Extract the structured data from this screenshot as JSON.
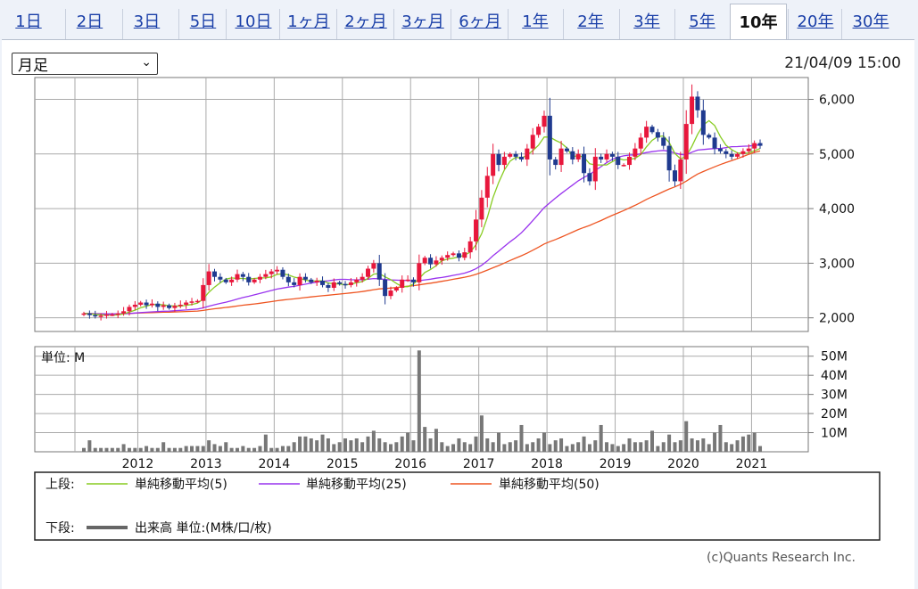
{
  "tabs": [
    {
      "label": "1日"
    },
    {
      "label": "2日"
    },
    {
      "label": "3日"
    },
    {
      "label": "5日"
    },
    {
      "label": "10日"
    },
    {
      "label": "1ヶ月"
    },
    {
      "label": "2ヶ月"
    },
    {
      "label": "3ヶ月"
    },
    {
      "label": "6ヶ月"
    },
    {
      "label": "1年"
    },
    {
      "label": "2年"
    },
    {
      "label": "3年"
    },
    {
      "label": "5年"
    },
    {
      "label": "10年",
      "active": true
    },
    {
      "label": "20年"
    },
    {
      "label": "30年"
    }
  ],
  "period_select": {
    "value": "月足"
  },
  "datetime": "21/04/09 15:00",
  "volume_unit_label": "単位: M",
  "legend": {
    "upper_label": "上段:",
    "lower_label": "下段:",
    "items": [
      {
        "label": "単純移動平均(5)",
        "color": "#88cc22"
      },
      {
        "label": "単純移動平均(25)",
        "color": "#9933ee"
      },
      {
        "label": "単純移動平均(50)",
        "color": "#ee5522"
      }
    ],
    "volume_item": {
      "label": "出来高 単位:(M株/口/枚)",
      "color": "#666666"
    }
  },
  "copyright": "(c)Quants Research Inc.",
  "chart_data": {
    "type": "candlestick",
    "x_labels": [
      "2012",
      "2013",
      "2014",
      "2015",
      "2016",
      "2017",
      "2018",
      "2019",
      "2020",
      "2021"
    ],
    "price_axis": {
      "ticks": [
        "6,000",
        "5,000",
        "4,000",
        "3,000",
        "2,000"
      ],
      "min": 1750,
      "max": 6400
    },
    "volume_axis": {
      "ticks": [
        "50M",
        "40M",
        "30M",
        "20M",
        "10M"
      ],
      "max": 55
    },
    "colors": {
      "up": "#e8173c",
      "down": "#1f3a8f",
      "ma5": "#88cc22",
      "ma25": "#9933ee",
      "ma50": "#ee5522",
      "volume": "#777777"
    },
    "close": [
      2080,
      2050,
      2030,
      2040,
      2060,
      2060,
      2080,
      2120,
      2200,
      2240,
      2280,
      2230,
      2260,
      2200,
      2230,
      2180,
      2220,
      2240,
      2280,
      2300,
      2310,
      2600,
      2850,
      2750,
      2700,
      2650,
      2700,
      2800,
      2750,
      2650,
      2700,
      2750,
      2800,
      2850,
      2880,
      2750,
      2650,
      2600,
      2750,
      2700,
      2650,
      2680,
      2600,
      2550,
      2650,
      2620,
      2600,
      2650,
      2700,
      2750,
      2900,
      3000,
      2700,
      2400,
      2500,
      2550,
      2700,
      2700,
      2650,
      3000,
      3100,
      2980,
      3050,
      3100,
      3150,
      3180,
      3100,
      3200,
      3400,
      3800,
      4200,
      4600,
      5000,
      4800,
      4950,
      5000,
      4950,
      4900,
      5100,
      5350,
      5500,
      5700,
      4900,
      4800,
      5100,
      5050,
      4900,
      5000,
      4650,
      4500,
      4950,
      4900,
      5000,
      4950,
      4800,
      4800,
      4950,
      5100,
      5300,
      5500,
      5400,
      5300,
      5150,
      4700,
      4500,
      4900,
      5550,
      6050,
      5800,
      5350,
      5300,
      5100,
      5050,
      5000,
      4950,
      5000,
      5050,
      5100,
      5200,
      5150
    ],
    "volume": [
      2,
      6,
      2,
      2,
      2,
      2,
      2,
      4,
      2,
      2,
      2,
      3,
      2,
      2,
      5,
      2,
      2,
      2,
      3,
      3,
      3,
      3,
      6,
      4,
      3,
      5,
      2,
      2,
      3,
      2,
      2,
      3,
      9,
      2,
      2,
      3,
      3,
      5,
      8,
      8,
      7,
      6,
      9,
      7,
      4,
      5,
      7,
      6,
      7,
      5,
      8,
      11,
      7,
      5,
      4,
      5,
      8,
      10,
      6,
      53,
      13,
      7,
      12,
      5,
      3,
      4,
      7,
      5,
      4,
      8,
      19,
      7,
      5,
      10,
      4,
      5,
      6,
      14,
      4,
      5,
      7,
      10,
      4,
      6,
      7,
      3,
      4,
      5,
      8,
      4,
      6,
      14,
      5,
      4,
      3,
      4,
      7,
      5,
      5,
      6,
      11,
      3,
      5,
      9,
      5,
      6,
      16,
      7,
      6,
      7,
      4,
      10,
      14,
      5,
      4,
      6,
      8,
      9,
      10,
      3
    ]
  }
}
